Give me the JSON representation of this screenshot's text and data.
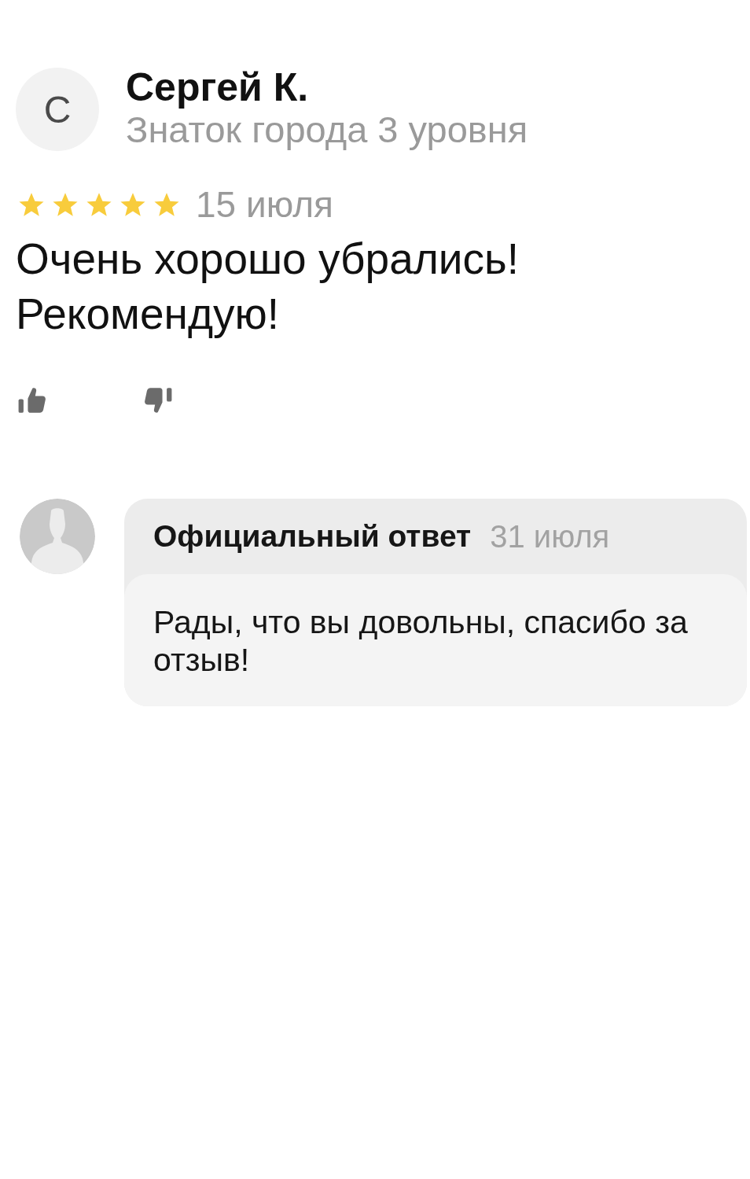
{
  "reviewer": {
    "initial": "С",
    "name": "Сергей К.",
    "status": "Знаток города 3 уровня"
  },
  "review": {
    "stars": 5,
    "date": "15 июля",
    "text": "Очень хорошо убрались! Рекомендую!"
  },
  "reply": {
    "title": "Официальный ответ",
    "date": "31 июля",
    "text": "Рады, что вы довольны, спасибо за отзыв!"
  }
}
